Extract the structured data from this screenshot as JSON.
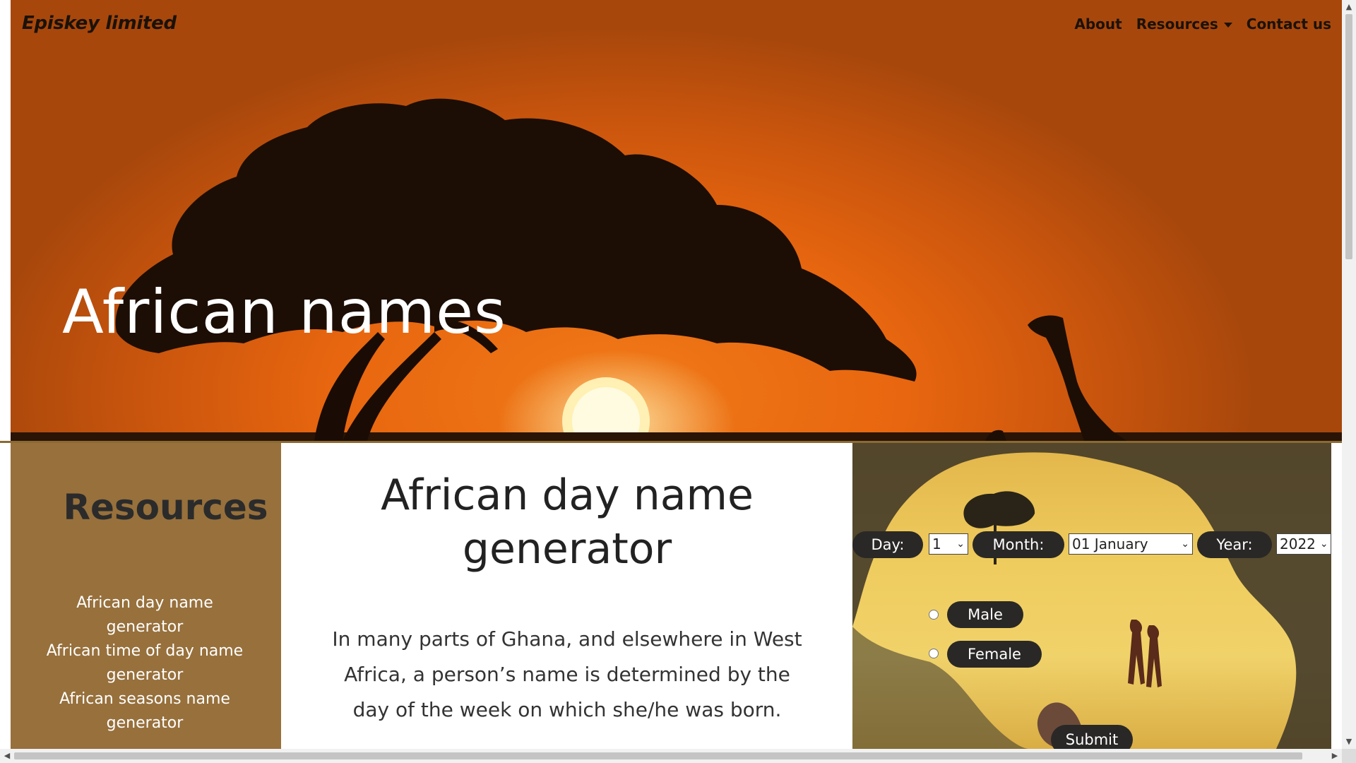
{
  "navbar": {
    "brand": "Episkey limited",
    "links": {
      "about": "About",
      "resources": "Resources",
      "contact": "Contact us"
    }
  },
  "hero": {
    "title": "African names"
  },
  "sidebar": {
    "heading": "Resources",
    "links": [
      "African day name generator",
      "African time of day name generator",
      "African seasons name generator"
    ]
  },
  "main": {
    "title": "African day name generator",
    "intro": "In many parts of Ghana, and elsewhere in West Africa, a person’s name is determined by the day of the week on which she/he was born."
  },
  "form": {
    "day_label": "Day:",
    "day_value": "1",
    "month_label": "Month:",
    "month_value": "01 January",
    "year_label": "Year:",
    "year_value": "2022",
    "male_label": "Male",
    "female_label": "Female",
    "submit_label": "Submit"
  },
  "colors": {
    "sidebar_bg": "#97703c",
    "hero_orange": "#e8660f",
    "pill_dark": "#2a2826"
  },
  "icons": {
    "dropdown": "caret-down-icon",
    "select": "chevron-down-icon",
    "scroll_up": "arrow-up-icon",
    "scroll_down": "arrow-down-icon",
    "scroll_left": "arrow-left-icon",
    "scroll_right": "arrow-right-icon"
  }
}
